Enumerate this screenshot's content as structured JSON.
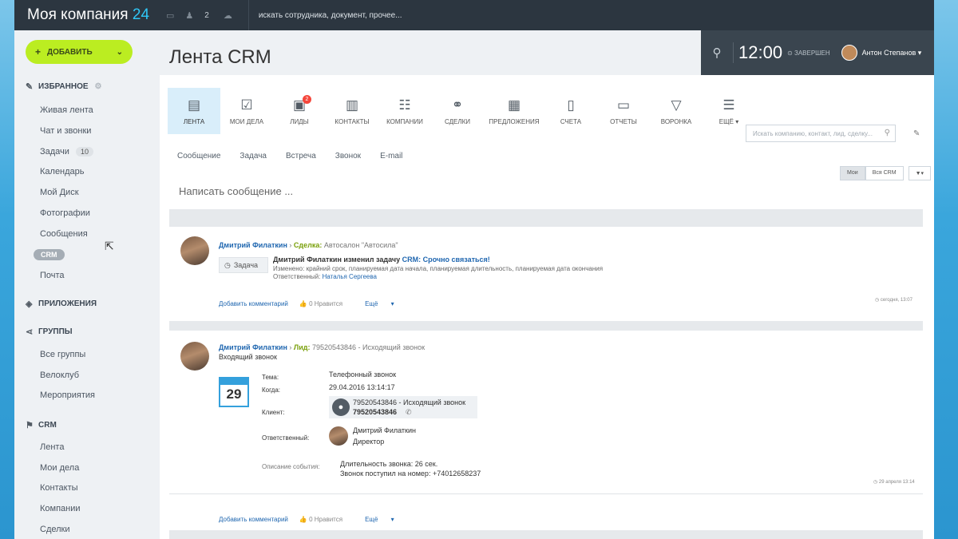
{
  "topbar": {
    "logo_text": "Моя компания",
    "logo_num": "24",
    "notify_count": "2",
    "search_text": "искать сотрудника, документ, прочее..."
  },
  "header": {
    "add_button": "ДОБАВИТЬ",
    "page_title": "Лента CRM",
    "clock": "12:00",
    "clock_status": "ЗАВЕРШЕН",
    "user_name": "Антон Степанов"
  },
  "sidebar": {
    "favorites_title": "ИЗБРАННОЕ",
    "favorites": [
      "Живая лента",
      "Чат и звонки",
      "Задачи",
      "Календарь",
      "Мой Диск",
      "Фотографии",
      "Сообщения",
      "CRM",
      "Почта"
    ],
    "tasks_badge": "10",
    "apps_title": "ПРИЛОЖЕНИЯ",
    "groups_title": "ГРУППЫ",
    "groups": [
      "Все группы",
      "Велоклуб",
      "Мероприятия"
    ],
    "crm_title": "CRM",
    "crm_items": [
      "Лента",
      "Мои дела",
      "Контакты",
      "Компании",
      "Сделки"
    ]
  },
  "crm_nav": {
    "tabs": [
      "ЛЕНТА",
      "МОИ ДЕЛА",
      "ЛИДЫ",
      "КОНТАКТЫ",
      "КОМПАНИИ",
      "СДЕЛКИ",
      "ПРЕДЛОЖЕНИЯ",
      "СЧЕТА",
      "ОТЧЕТЫ",
      "ВОРОНКА",
      "ЕЩЁ"
    ],
    "leads_badge": "2",
    "search_placeholder": "Искать компанию, контакт, лид, сделку..."
  },
  "post_tabs": [
    "Сообщение",
    "Задача",
    "Встреча",
    "Звонок",
    "E-mail"
  ],
  "filter": {
    "mine": "Мои",
    "all": "Вся CRM"
  },
  "write_placeholder": "Написать сообщение ...",
  "feed": [
    {
      "author": "Дмитрий Филаткин",
      "entity_type": "Сделка:",
      "entity_name": "Автосалон \"Автосила\"",
      "chip": "Задача",
      "headline_prefix": "Дмитрий Филаткин изменил задачу",
      "headline_task": "CRM: Срочно связаться!",
      "changed_label": "Изменено:",
      "changed_text": "крайний срок, планируемая дата начала, планируемая длительность, планируемая дата окончания",
      "responsible_label": "Ответственный:",
      "responsible_name": "Наталья Сергеева",
      "add_comment": "Добавить комментарий",
      "likes": "0 Нравится",
      "more": "Ещё",
      "time": "сегодня, 13:07"
    },
    {
      "author": "Дмитрий Филаткин",
      "entity_type": "Лид:",
      "entity_name": "79520543846 - Исходящий звонок",
      "subtitle": "Входящий звонок",
      "cal_day": "29",
      "theme_label": "Тема:",
      "theme": "Телефонный звонок",
      "when_label": "Когда:",
      "when": "29.04.2016 13:14:17",
      "client_label": "Клиент:",
      "client_link": "79520543846 - Исходящий звонок",
      "client_phone": "79520543846",
      "responsible_label": "Ответственный:",
      "responsible_name": "Дмитрий Филаткин",
      "responsible_role": "Директор",
      "desc_label": "Описание события:",
      "desc_line1": "Длительность звонка: 26 сек.",
      "desc_line2": "Звонок поступил на номер: +74012658237",
      "add_comment": "Добавить комментарий",
      "likes": "0 Нравится",
      "more": "Ещё",
      "time": "29 апреля 13:14"
    }
  ],
  "colors": {
    "topbar": "#2c3640",
    "add_button": "#bbed21",
    "link": "#2067b0",
    "deal": "#7aa00b",
    "active_tab": "#d9eefa"
  }
}
